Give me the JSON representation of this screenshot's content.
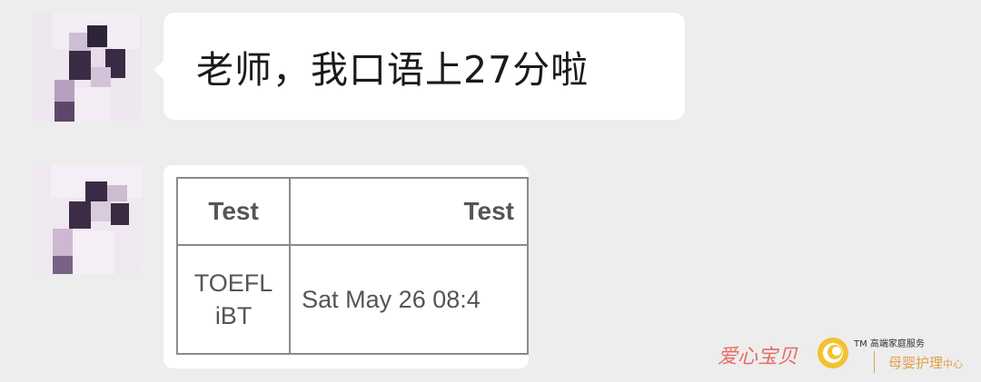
{
  "conversation": {
    "messages": [
      {
        "type": "text",
        "text": "老师，我口语上27分啦"
      },
      {
        "type": "image",
        "table": {
          "headers": [
            "Test",
            "Test"
          ],
          "rows": [
            {
              "test_line1": "TOEFL",
              "test_line2": "iBT",
              "date": "Sat May 26 08:4"
            }
          ]
        }
      }
    ]
  },
  "watermark": {
    "brand": "爱心宝贝",
    "tm_text": "TM 高端家庭服务",
    "subtitle": "母婴护理",
    "subtitle_small": "中心",
    "colors": {
      "brand": "#e56d66",
      "accent": "#e2a04a",
      "logo": "#f2c230"
    }
  }
}
